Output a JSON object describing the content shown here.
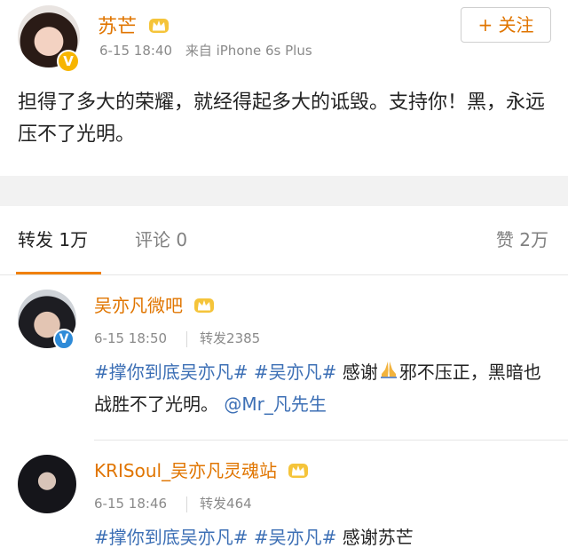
{
  "post": {
    "author": "苏芒",
    "timestamp": "6-15 18:40",
    "source": "来自 iPhone 6s Plus",
    "follow_label": "+ 关注",
    "text": "担得了多大的荣耀，就经得起多大的诋毁。支持你！黑，永远压不了光明。",
    "verified_mark": "V"
  },
  "tabs": {
    "repost": "转发 1万",
    "comment": "评论 0",
    "like": "赞 2万"
  },
  "reposts": [
    {
      "author": "吴亦凡微吧",
      "timestamp": "6-15 18:50",
      "count": "转发2385",
      "verified_mark": "V",
      "topic_1": "#撑你到底吴亦凡#",
      "topic_2": "#吴亦凡#",
      "text_a": "感谢",
      "text_b": "邪不压正，黑暗也战胜不了光明。",
      "mention": "@Mr_凡先生"
    },
    {
      "author": "KRISoul_吴亦凡灵魂站",
      "timestamp": "6-15 18:46",
      "count": "转发464",
      "topic_1": "#撑你到底吴亦凡#",
      "topic_2": "#吴亦凡#",
      "text_a": "感谢苏芒"
    }
  ],
  "colors": {
    "accent": "#f08000",
    "name": "#e07500",
    "link": "#3c6fb5",
    "muted": "#8a8a8a"
  },
  "icons": {
    "crown": "vip-crown-icon",
    "verified": "verified-badge-icon",
    "pray": "praying-hands-icon"
  }
}
